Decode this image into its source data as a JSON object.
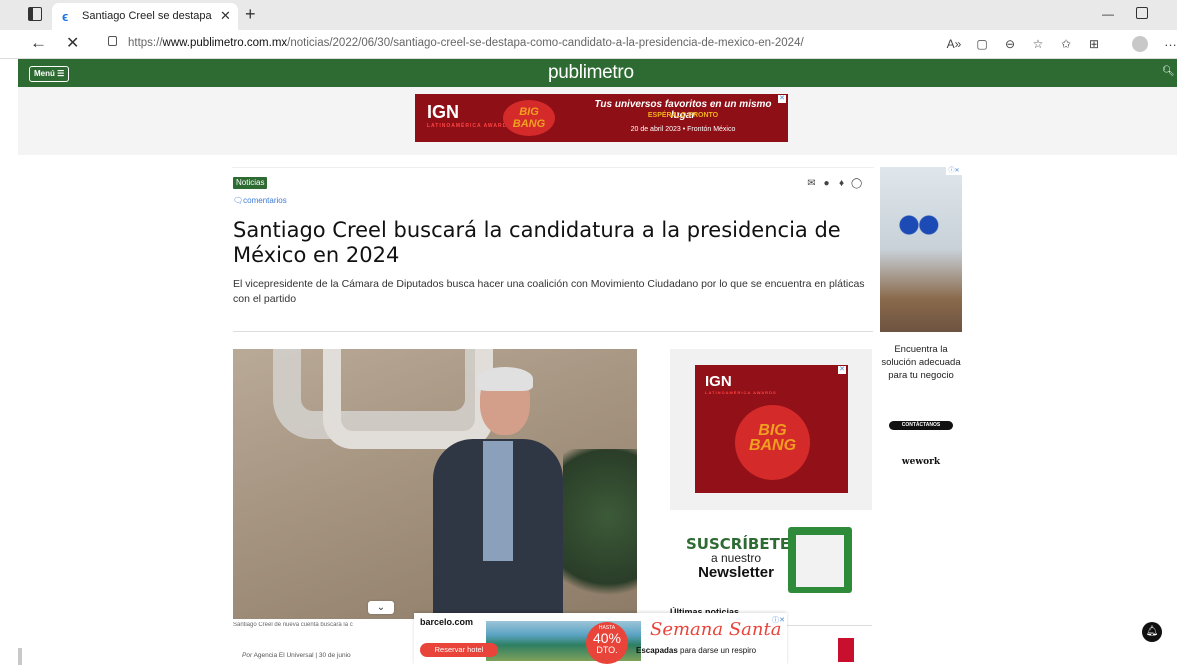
{
  "browser": {
    "tab_title": "Santiago Creel se destapa como",
    "url_prefix": "https://",
    "url_domain": "www.publimetro.com.mx",
    "url_path": "/noticias/2022/06/30/santiago-creel-se-destapa-como-candidato-a-la-presidencia-de-mexico-en-2024/"
  },
  "site": {
    "menu_label": "Menú ☰",
    "logo": "publimetro"
  },
  "top_ad": {
    "brand": "IGN",
    "brand_sub": "LATINOAMÉRICA AWARDS",
    "event": "BIG BANG",
    "headline": "Tus universos favoritos en un mismo lugar",
    "sub": "ESPÉRALO PRONTO",
    "date": "20 de abril 2023 • Frontón México"
  },
  "article": {
    "category": "Noticias",
    "comments": "comentarios",
    "headline": "Santiago Creel buscará la candidatura a la presidencia de México en 2024",
    "subheadline": "El vicepresidente de la Cámara de Diputados busca hacer una coalición con Movimiento Ciudadano por lo que se encuentra en pláticas con el partido",
    "photo_caption": "Santiago Creel de nueva cuenta buscará la c",
    "byline_prefix": "Por",
    "byline": "Agencia El Universal | 30 de junio"
  },
  "sidebar": {
    "ad_brand": "IGN",
    "ad_brand_sub": "LATINOAMÉRICA AWARDS",
    "newsletter_subscribe": "SUSCRÍBETE",
    "newsletter_a_nuestro": "a nuestro",
    "newsletter_label": "Newsletter",
    "partial_text": "Últimas noticias"
  },
  "wework_ad": {
    "text": "Encuentra la solución adecuada para tu negocio",
    "cta": "CONTÁCTANOS",
    "logo": "wework"
  },
  "bottom_ad": {
    "domain": "barcelo.com",
    "cta": "Reservar hotel",
    "badge_hasta": "HASTA",
    "badge_pct": "40%",
    "badge_dto": "DTO.",
    "title": "Semana Santa",
    "tagline_bold": "Escapadas",
    "tagline_rest": " para darse un respiro"
  }
}
